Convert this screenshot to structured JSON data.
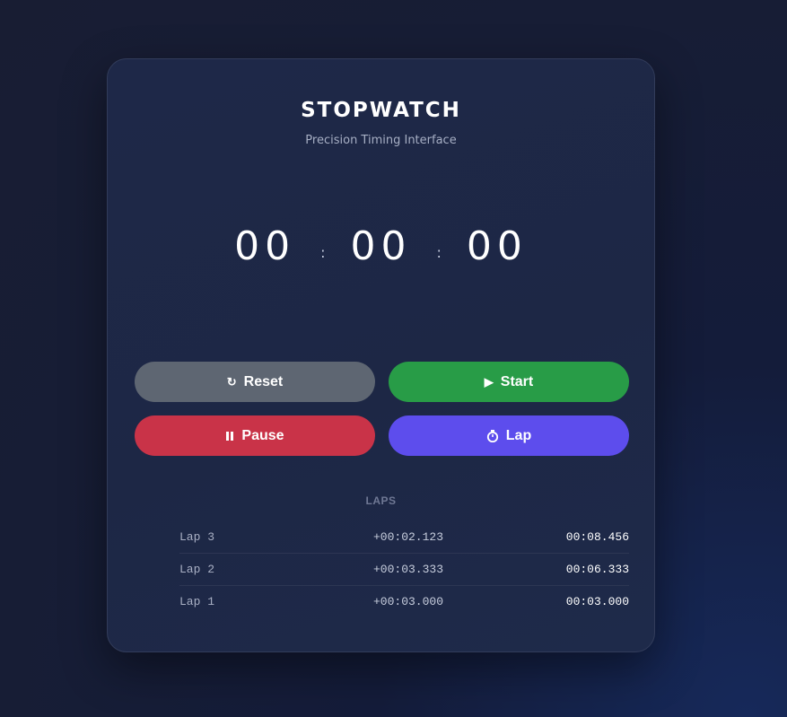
{
  "header": {
    "title": "STOPWATCH",
    "subtitle": "Precision Timing Interface"
  },
  "display": {
    "minutes": "00",
    "seconds": "00",
    "centiseconds": "00",
    "separator": ":"
  },
  "buttons": {
    "reset": {
      "icon": "reset-icon",
      "glyph": "↻",
      "label": "Reset",
      "color": "#5e6672"
    },
    "start": {
      "icon": "play-icon",
      "glyph": "▶",
      "label": "Start",
      "color": "#289c47"
    },
    "pause": {
      "icon": "pause-icon",
      "glyph": "⏸",
      "label": "Pause",
      "color": "#c93348"
    },
    "lap": {
      "icon": "stopwatch-icon",
      "glyph": "⏱",
      "label": "Lap",
      "color": "#5d4ded"
    }
  },
  "laps": {
    "heading": "LAPS",
    "rows": [
      {
        "name": "Lap 3",
        "split": "+00:02.123",
        "total": "00:08.456"
      },
      {
        "name": "Lap 2",
        "split": "+00:03.333",
        "total": "00:06.333"
      },
      {
        "name": "Lap 1",
        "split": "+00:03.000",
        "total": "00:03.000"
      }
    ]
  }
}
